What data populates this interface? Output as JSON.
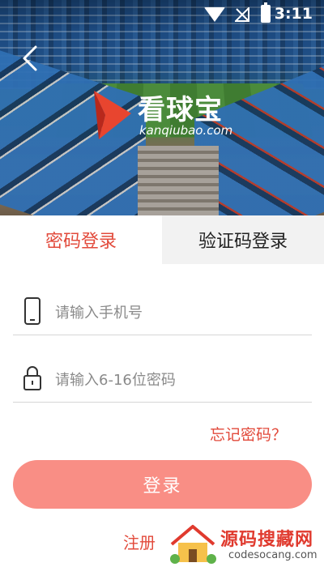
{
  "status_bar": {
    "time": "3:11",
    "icons": [
      "wifi-icon",
      "no-signal-icon",
      "battery-charging-icon"
    ]
  },
  "header": {
    "back_icon": "chevron-left-icon"
  },
  "logo": {
    "title": "看球宝",
    "subtitle": "kanqiubao.com",
    "icon": "red-play-triangle-icon"
  },
  "tabs": [
    {
      "label": "密码登录",
      "active": true
    },
    {
      "label": "验证码登录",
      "active": false
    }
  ],
  "form": {
    "phone": {
      "placeholder": "请输入手机号",
      "value": "",
      "icon": "phone-icon"
    },
    "password": {
      "placeholder": "请输入6-16位密码",
      "value": "",
      "icon": "lock-icon"
    },
    "forgot_label": "忘记密码？",
    "login_label": "登录",
    "register_label": "注册"
  },
  "watermark": {
    "title": "源码搜藏网",
    "url": "codesocang.com"
  },
  "colors": {
    "accent": "#e24a3b",
    "button": "#f98e85",
    "tab_inactive_bg": "#f2f2f2"
  }
}
